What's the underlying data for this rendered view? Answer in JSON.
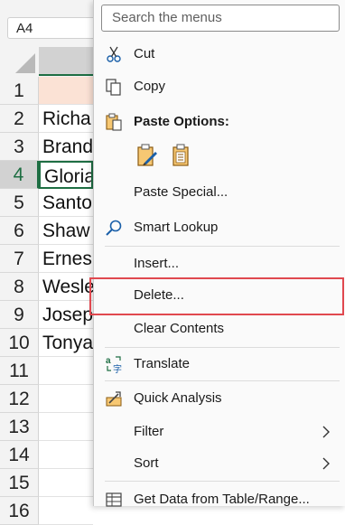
{
  "sheet": {
    "name_box": "A4",
    "row_numbers": [
      "1",
      "2",
      "3",
      "4",
      "5",
      "6",
      "7",
      "8",
      "9",
      "10",
      "11",
      "12",
      "13",
      "14",
      "15",
      "16"
    ],
    "active_row": "4",
    "col_a": [
      "",
      "Richa",
      "Brand",
      "Gloria",
      "Santo",
      "Shaw",
      "Ernes",
      "Wesle",
      "Josep",
      "Tonya",
      "",
      "",
      "",
      "",
      "",
      ""
    ],
    "colors": {
      "accent": "#1e6e43",
      "header_fill": "#fbe2d5"
    }
  },
  "menu": {
    "search_placeholder": "Search the menus",
    "cut": "Cut",
    "copy": "Copy",
    "paste_options": "Paste Options:",
    "paste_special": "Paste Special...",
    "smart_lookup": "Smart Lookup",
    "insert": "Insert...",
    "delete": "Delete...",
    "clear_contents": "Clear Contents",
    "translate": "Translate",
    "quick_analysis": "Quick Analysis",
    "filter": "Filter",
    "sort": "Sort",
    "get_data": "Get Data from Table/Range...",
    "highlight_color": "#e0484f",
    "icons": [
      "scissors-icon",
      "copy-icon",
      "paste-icon",
      "paste-keep-formatting-icon",
      "paste-values-icon",
      "smart-lookup-icon",
      "translate-icon",
      "quick-analysis-icon",
      "table-icon",
      "chevron-right-icon"
    ]
  }
}
